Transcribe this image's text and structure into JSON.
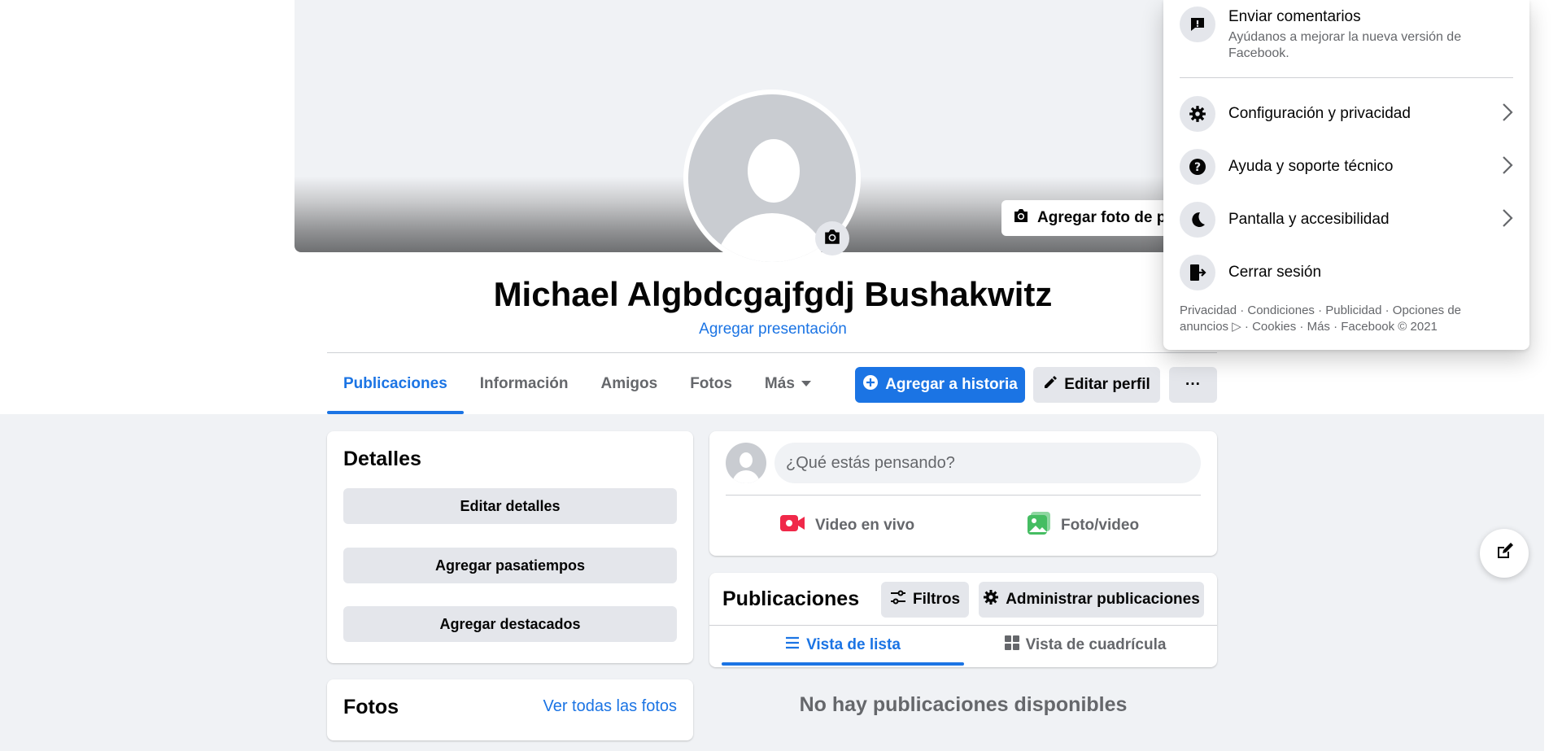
{
  "profile": {
    "name": "Michael Algbdcgajfgdj Bushakwitz",
    "add_bio": "Agregar presentación",
    "add_cover_photo": "Agregar foto de po"
  },
  "tabs": [
    {
      "label": "Publicaciones",
      "active": true
    },
    {
      "label": "Información"
    },
    {
      "label": "Amigos"
    },
    {
      "label": "Fotos"
    },
    {
      "label": "Más"
    }
  ],
  "actions": {
    "add_story": "Agregar a historia",
    "edit_profile": "Editar perfil",
    "more": "···"
  },
  "details": {
    "title": "Detalles",
    "buttons": [
      "Editar detalles",
      "Agregar pasatiempos",
      "Agregar destacados"
    ]
  },
  "photos": {
    "title": "Fotos",
    "see_all": "Ver todas las fotos"
  },
  "composer": {
    "placeholder": "¿Qué estás pensando?",
    "live_video": "Video en vivo",
    "photo_video": "Foto/video"
  },
  "posts": {
    "title": "Publicaciones",
    "filters": "Filtros",
    "manage": "Administrar publicaciones",
    "list_view": "Vista de lista",
    "grid_view": "Vista de cuadrícula",
    "empty": "No hay publicaciones disponibles"
  },
  "menu": {
    "feedback_title": "Enviar comentarios",
    "feedback_subtitle": "Ayúdanos a mejorar la nueva versión de Facebook.",
    "items": [
      {
        "label": "Configuración y privacidad",
        "icon": "gear-icon"
      },
      {
        "label": "Ayuda y soporte técnico",
        "icon": "help-icon"
      },
      {
        "label": "Pantalla y accesibilidad",
        "icon": "moon-icon"
      },
      {
        "label": "Cerrar sesión",
        "icon": "logout-icon"
      }
    ],
    "footer": "Privacidad · Condiciones · Publicidad · Opciones de anuncios ▷ · Cookies · Más · Facebook © 2021"
  },
  "colors": {
    "accent": "#1b74e4",
    "background": "#f0f2f5",
    "live_red": "#f02849",
    "photo_green": "#45bd62"
  }
}
